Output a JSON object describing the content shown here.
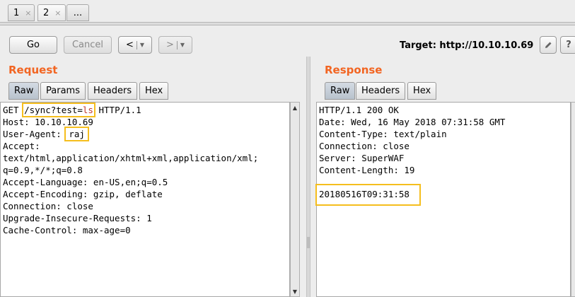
{
  "tabs": [
    {
      "label": "1",
      "close": "×"
    },
    {
      "label": "2",
      "close": "×"
    },
    {
      "label": "..."
    }
  ],
  "toolbar": {
    "go_label": "Go",
    "cancel_label": "Cancel",
    "back_label": "<",
    "forward_label": ">",
    "target_text": "Target: http://10.10.10.69",
    "help_label": "?"
  },
  "request": {
    "title": "Request",
    "tabs": [
      "Raw",
      "Params",
      "Headers",
      "Hex"
    ],
    "method": "GET ",
    "path": "/sync?test=",
    "param_value": "ls",
    "protocol": " HTTP/1.1",
    "host_line": "Host: 10.10.10.69",
    "ua_label": "User-Agent: ",
    "ua_value": "raj",
    "lines": [
      "Accept:",
      "text/html,application/xhtml+xml,application/xml;",
      "q=0.9,*/*;q=0.8",
      "Accept-Language: en-US,en;q=0.5",
      "Accept-Encoding: gzip, deflate",
      "Connection: close",
      "Upgrade-Insecure-Requests: 1",
      "Cache-Control: max-age=0"
    ]
  },
  "response": {
    "title": "Response",
    "tabs": [
      "Raw",
      "Headers",
      "Hex"
    ],
    "lines": [
      "HTTP/1.1 200 OK",
      "Date: Wed, 16 May 2018 07:31:58 GMT",
      "Content-Type: text/plain",
      "Connection: close",
      "Server: SuperWAF",
      "Content-Length: 19"
    ],
    "body": "20180516T09:31:58"
  },
  "colors": {
    "accent": "#f26522",
    "highlight": "#f5be1e",
    "param": "#c0392b"
  }
}
